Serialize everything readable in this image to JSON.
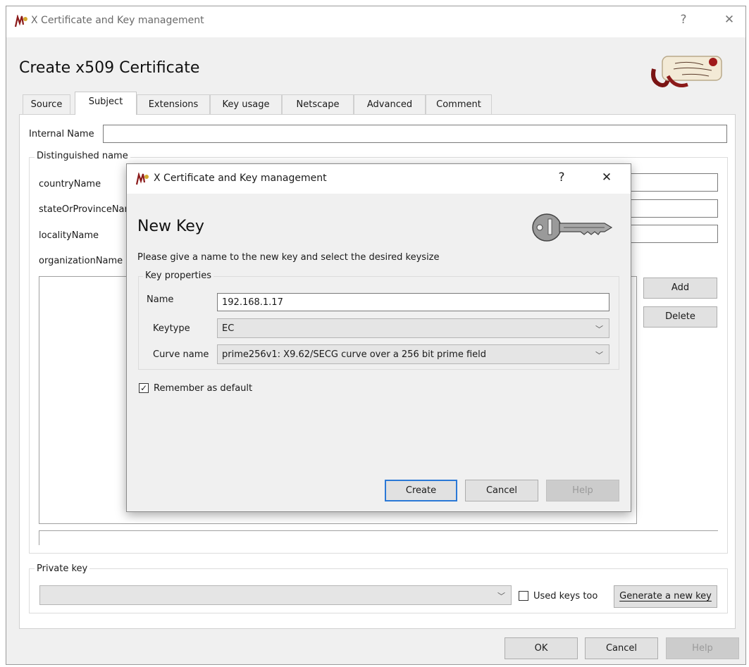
{
  "window": {
    "title": "X Certificate and Key management",
    "help_glyph": "?",
    "close_glyph": "✕",
    "heading": "Create x509 Certificate"
  },
  "tabs": [
    "Source",
    "Subject",
    "Extensions",
    "Key usage",
    "Netscape",
    "Advanced",
    "Comment"
  ],
  "active_tab": "Subject",
  "subject": {
    "internal_name_label": "Internal Name",
    "internal_name_value": "",
    "distinguished_group": "Distinguished name",
    "fields": [
      {
        "label": "countryName",
        "value": ""
      },
      {
        "label": "stateOrProvinceName",
        "value": ""
      },
      {
        "label": "localityName",
        "value": ""
      },
      {
        "label": "organizationName",
        "value": ""
      }
    ],
    "add_button": "Add",
    "delete_button": "Delete"
  },
  "private_key": {
    "group": "Private key",
    "selected": "",
    "used_keys_label": "Used keys too",
    "used_keys_checked": false,
    "generate_button": "Generate a new key"
  },
  "footer": {
    "ok": "OK",
    "cancel": "Cancel",
    "help": "Help"
  },
  "dialog": {
    "title": "X Certificate and Key management",
    "help_glyph": "?",
    "close_glyph": "✕",
    "heading": "New Key",
    "description": "Please give a name to the new key and select the desired keysize",
    "group": "Key properties",
    "name_label": "Name",
    "name_value": "192.168.1.17",
    "keytype_label": "Keytype",
    "keytype_value": "EC",
    "curve_label": "Curve name",
    "curve_value": "prime256v1: X9.62/SECG curve over a 256 bit prime field",
    "remember_label": "Remember as default",
    "remember_checked": true,
    "create": "Create",
    "cancel": "Cancel",
    "help": "Help"
  },
  "icons": {
    "app": "xca-app-icon",
    "certificate": "certificate-scroll-icon",
    "key": "key-icon",
    "dropdown": "chevron-down-icon",
    "check": "checkmark-icon"
  },
  "colors": {
    "focus_border": "#2b79d6",
    "window_bg": "#f0f0f0",
    "scroll_red": "#8b1a1a"
  }
}
